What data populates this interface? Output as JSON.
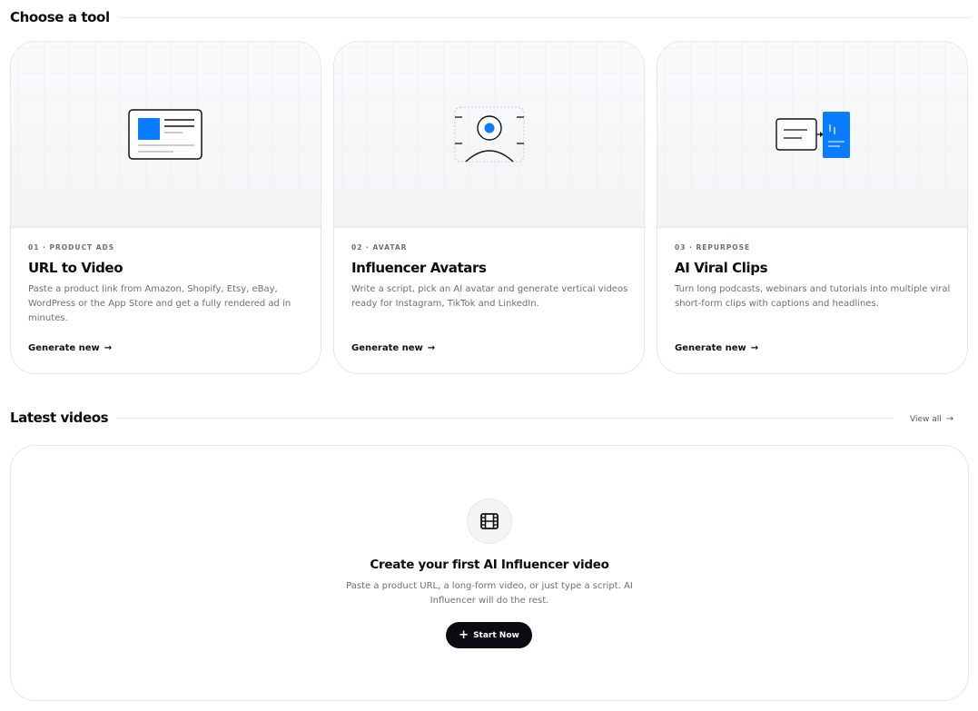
{
  "tools_section": {
    "title": "Choose a tool",
    "cards": [
      {
        "eyebrow": "01 · PRODUCT ADS",
        "title": "URL to Video",
        "description": "Paste a product link from Amazon, Shopify, Etsy, eBay, WordPress or the App Store and get a fully rendered ad in minutes.",
        "cta": "Generate new",
        "icon": "product-page-illustration"
      },
      {
        "eyebrow": "02 · AVATAR",
        "title": "Influencer Avatars",
        "description": "Write a script, pick an AI avatar and generate vertical videos ready for Instagram, TikTok and LinkedIn.",
        "cta": "Generate new",
        "icon": "avatar-frame-illustration"
      },
      {
        "eyebrow": "03 · REPURPOSE",
        "title": "AI Viral Clips",
        "description": "Turn long podcasts, webinars and tutorials into multiple viral short-form clips with captions and headlines.",
        "cta": "Generate new",
        "icon": "clip-repurpose-illustration"
      }
    ]
  },
  "videos_section": {
    "title": "Latest videos",
    "view_all": "View all",
    "empty_state": {
      "icon": "film-icon",
      "title": "Create your first AI Influencer video",
      "description": "Paste a product URL, a long-form video, or just type a script. AI Influencer will do the rest.",
      "button": "Start Now"
    }
  },
  "colors": {
    "accent": "#0a7cff",
    "dark": "#0b0b12",
    "muted_text": "#6b6f76",
    "border": "#e7e7ea"
  }
}
